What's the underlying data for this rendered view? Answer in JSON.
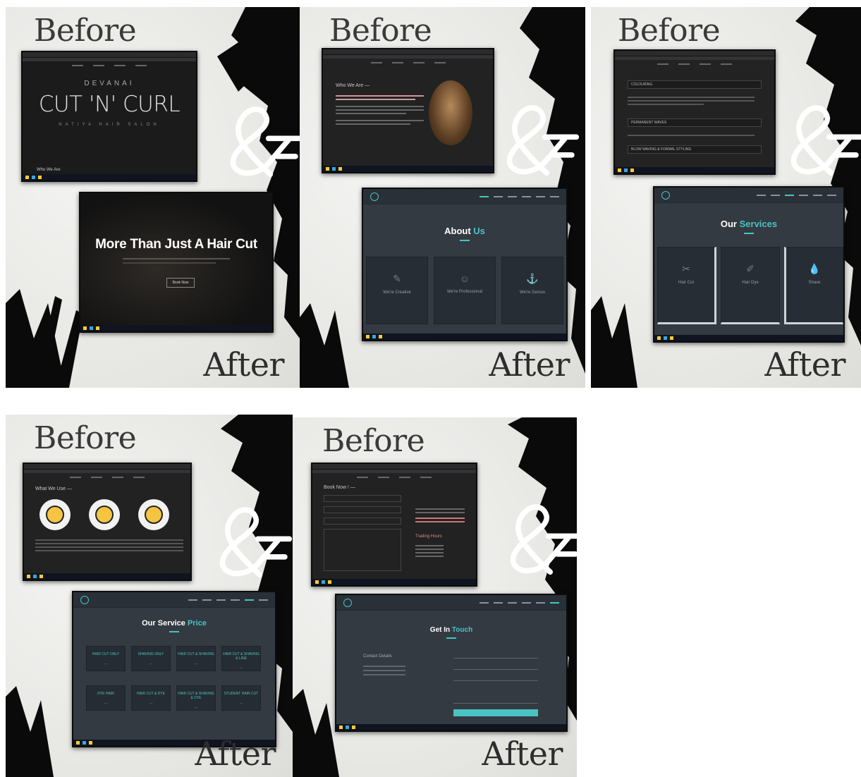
{
  "labels": {
    "before": "Before",
    "after": "After"
  },
  "colors": {
    "accent": "#49c3c3",
    "dark": "#1b1b1b",
    "site": "#333a42"
  },
  "panel1": {
    "before_site": {
      "small": "DEVANAI",
      "title": "CUT 'N' CURL",
      "tagline": "NATIYA HAIR SALON",
      "footer": "Who We Are"
    },
    "after_site": {
      "headline": "More Than Just A Hair Cut",
      "button": "Book Now"
    }
  },
  "panel2": {
    "before_site": {
      "heading": "Who We Are —"
    },
    "after_site": {
      "title_a": "About ",
      "title_b": "Us",
      "tiles": [
        "We're Creative",
        "We're Professional",
        "We're Genius"
      ]
    }
  },
  "panel3": {
    "before_site": {
      "rows": [
        "COLOURING",
        "PERMANENT WAVES",
        "BLOW WAVING & FORMAL STYLING"
      ]
    },
    "after_site": {
      "title_a": "Our ",
      "title_b": "Services",
      "tiles": [
        "Hair Cut",
        "Hair Dye",
        "Shave"
      ]
    }
  },
  "panel4": {
    "before_site": {
      "heading": "What We Use —"
    },
    "after_site": {
      "title_a": "Our Service ",
      "title_b": "Price",
      "items": [
        "HAIR CUT ONLY",
        "SHAVING ONLY",
        "HAIR CUT & SHAVING",
        "HAIR CUT & SHAVING & LINE",
        "DYE HAIR",
        "HAIR CUT & DYE",
        "HAIR CUT & SHAVING & DYE",
        "STUDENT HAIR CUT"
      ]
    }
  },
  "panel5": {
    "before_site": {
      "heading": "Book Now ! —",
      "hours": "Trading Hours"
    },
    "after_site": {
      "title_a": "Get In ",
      "title_b": "Touch",
      "contact": "Contact Details"
    }
  }
}
